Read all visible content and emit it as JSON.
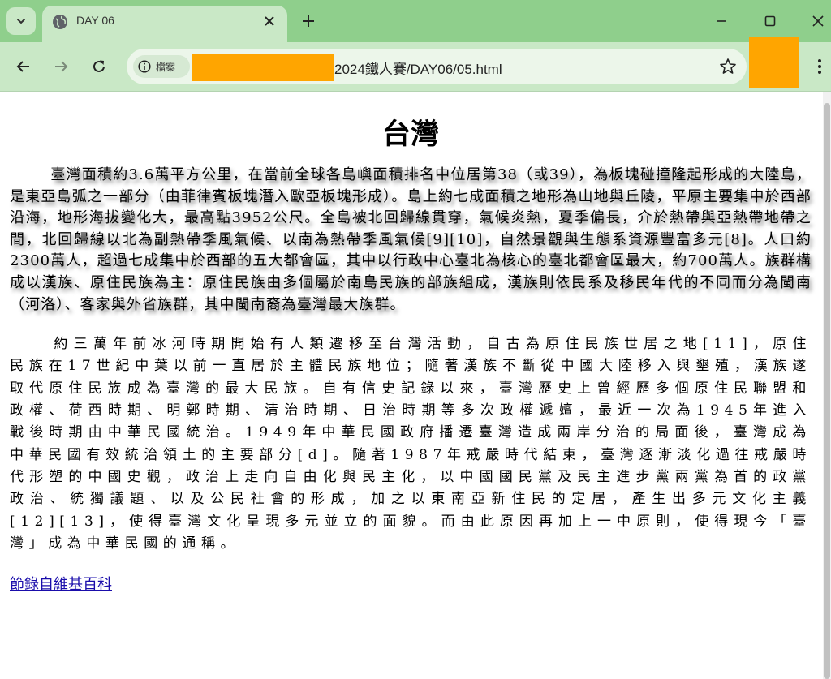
{
  "browser": {
    "tab_title": "DAY 06",
    "site_chip_label": "檔案",
    "url_visible": "2024鐵人賽/DAY06/05.html"
  },
  "icons": {
    "tab_search": "chevron-down-icon",
    "tab_favicon": "globe-icon",
    "tab_close": "close-icon",
    "new_tab": "plus-icon",
    "minimize": "minimize-icon",
    "maximize": "maximize-icon",
    "window_close": "close-icon",
    "back": "back-arrow-icon",
    "forward": "forward-arrow-icon",
    "reload": "reload-icon",
    "info": "info-icon",
    "bookmark": "star-icon",
    "menu": "more-vert-icon"
  },
  "colors": {
    "tab_strip": "#8fcf8c",
    "toolbar": "#c9e8c6",
    "redaction": "#ffa500",
    "link": "#1a0dab"
  },
  "page": {
    "heading": "台灣",
    "paragraph1": "臺灣面積約3.6萬平方公里，在當前全球各島嶼面積排名中位居第38（或39），為板塊碰撞隆起形成的大陸島，是東亞島弧之一部分（由菲律賓板塊潛入歐亞板塊形成）。島上約七成面積之地形為山地與丘陵，平原主要集中於西部沿海，地形海拔變化大，最高點3952公尺。全島被北回歸線貫穿，氣候炎熱，夏季偏長，介於熱帶與亞熱帶地帶之間，北回歸線以北為副熱帶季風氣候、以南為熱帶季風氣候[9][10]，自然景觀與生態系資源豐富多元[8]。人口約2300萬人，超過七成集中於西部的五大都會區，其中以行政中心臺北為核心的臺北都會區最大，約700萬人。族群構成以漢族、原住民族為主：原住民族由多個屬於南島民族的部族組成，漢族則依民系及移民年代的不同而分為閩南（河洛）、客家與外省族群，其中閩南裔為臺灣最大族群。",
    "paragraph2": "約三萬年前冰河時期開始有人類遷移至台灣活動，自古為原住民族世居之地[11]，原住民族在17世紀中葉以前一直居於主體民族地位；隨著漢族不斷從中國大陸移入與墾殖，漢族遂取代原住民族成為臺灣的最大民族。自有信史記錄以來，臺灣歷史上曾經歷多個原住民聯盟和政權、荷西時期、明鄭時期、清治時期、日治時期等多次政權遞嬗，最近一次為1945年進入戰後時期由中華民國統治。1949年中華民國政府播遷臺灣造成兩岸分治的局面後，臺灣成為中華民國有效統治領土的主要部分[d]。隨著1987年戒嚴時代結束，臺灣逐漸淡化過往戒嚴時代形塑的中國史觀，政治上走向自由化與民主化，以中國國民黨及民主進步黨兩黨為首的政黨政治、統獨議題、以及公民社會的形成，加之以東南亞新住民的定居，產生出多元文化主義[12][13]，使得臺灣文化呈現多元並立的面貌。而由此原因再加上一中原則，使得現今「臺灣」成為中華民國的通稱。",
    "source_link": "節錄自維基百科"
  }
}
